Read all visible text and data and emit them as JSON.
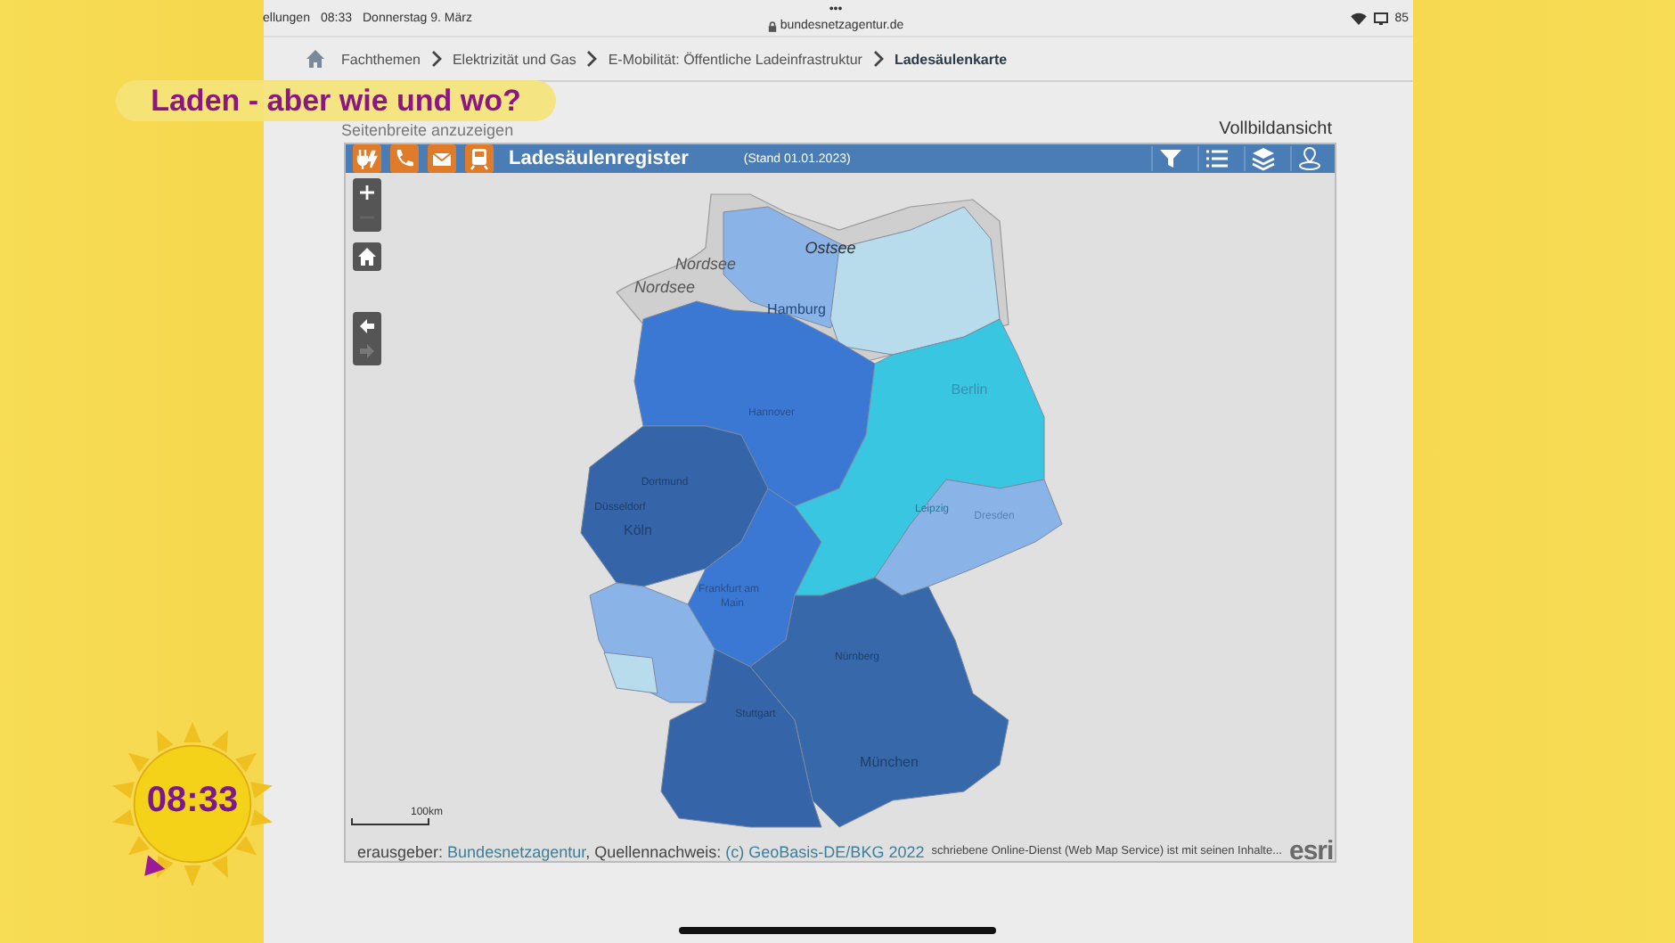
{
  "status_bar": {
    "app": "ellungen",
    "time": "08:33",
    "date": "Donnerstag 9. März",
    "dots": "•••",
    "url": "bundesnetzagentur.de",
    "battery": "85"
  },
  "breadcrumb": [
    {
      "label": "Fachthemen",
      "current": false
    },
    {
      "label": "Elektrizität und Gas",
      "current": false
    },
    {
      "label": "E-Mobilität: Öffentliche Ladeinfrastruktur",
      "current": false
    },
    {
      "label": "Ladesäulenkarte",
      "current": true
    }
  ],
  "hint": "Seitenbreite anzuzeigen",
  "fullscreen_link": "Vollbildansicht",
  "map_panel": {
    "title": "Ladesäulenregister",
    "stand": "(Stand 01.01.2023)",
    "zoom_controls": [
      {
        "kind": "in",
        "disabled": false
      },
      {
        "kind": "out",
        "disabled": true
      }
    ],
    "nav_controls": [
      {
        "kind": "back",
        "disabled": false
      },
      {
        "kind": "forward",
        "disabled": true
      }
    ],
    "regions": [
      {
        "color": "#8ab4e8"
      },
      {
        "color": "#b8dcec"
      },
      {
        "color": "#3a78d4"
      },
      {
        "color": "#3565a8"
      },
      {
        "color": "#3a78d4"
      },
      {
        "color": "#38c6e0"
      },
      {
        "color": "#8ab4e8"
      },
      {
        "color": "#8ab4e8"
      },
      {
        "color": "#b8dcec"
      },
      {
        "color": "#3668aa"
      },
      {
        "color": "#3565a8"
      }
    ],
    "labels": [
      "Ostsee",
      "Nordsee",
      "Nordsee",
      "Hamburg",
      "Hannover",
      "Berlin",
      "Dortmund",
      "Düsseldorf",
      "Köln",
      "Leipzig",
      "Dresden",
      "Frankfurt am",
      "Main",
      "Nürnberg",
      "Stuttgart",
      "München"
    ],
    "scale": "100km",
    "attribution": [
      {
        "kind": "text",
        "text": "erausgeber: "
      },
      {
        "kind": "link",
        "text": "Bundesnetzagentur"
      },
      {
        "kind": "text",
        "text": ", Quellennachweis: "
      },
      {
        "kind": "link",
        "text": "(c) GeoBasis-DE/BKG 2022"
      }
    ],
    "disclaimer": "schriebene Online-Dienst (Web Map Service) ist mit seinen Inhalte...",
    "logo": "esri"
  },
  "banner": "Laden - aber wie und wo?",
  "clock": "08:33"
}
